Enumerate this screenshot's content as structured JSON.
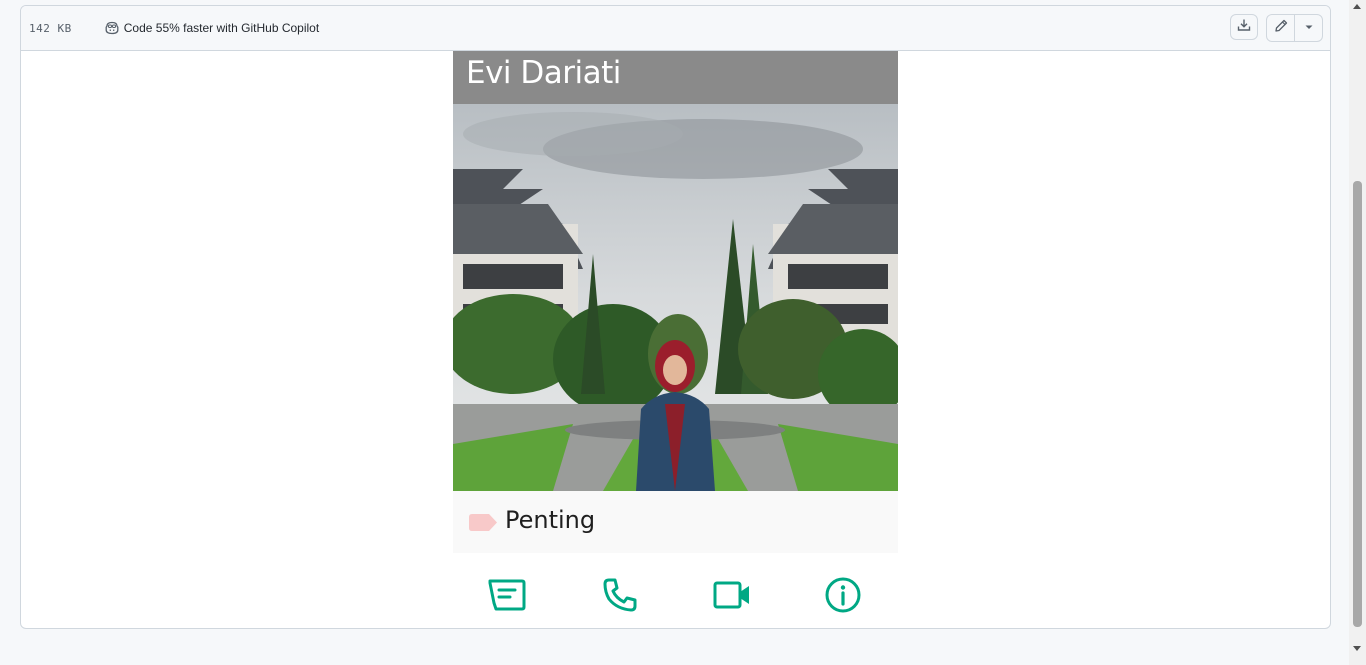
{
  "file_header": {
    "size": "142 KB",
    "copilot_text": "Code 55% faster with GitHub Copilot",
    "copilot_icon": "copilot-icon",
    "download_icon": "download-icon",
    "edit_icon": "pencil-icon",
    "more_icon": "triangle-down-icon"
  },
  "contact_card": {
    "name": "Evi Dariati",
    "label": "Penting",
    "label_color": "#f8c9c9",
    "accent_color": "#00a884",
    "actions": [
      {
        "name": "message",
        "icon": "message-icon"
      },
      {
        "name": "call",
        "icon": "phone-icon"
      },
      {
        "name": "video",
        "icon": "video-icon"
      },
      {
        "name": "info",
        "icon": "info-icon"
      }
    ]
  }
}
